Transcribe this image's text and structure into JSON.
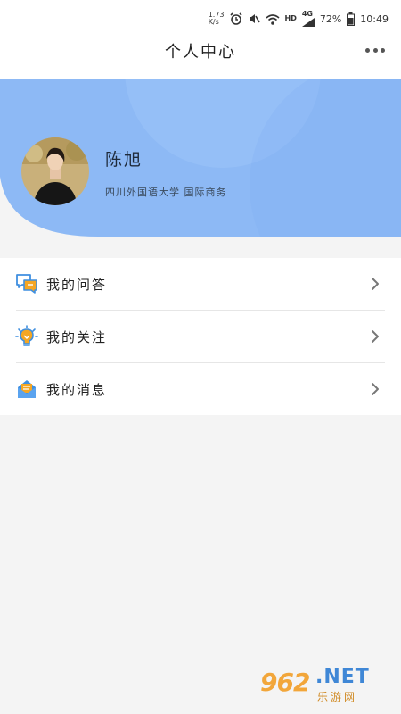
{
  "status_bar": {
    "network_a": "1.73",
    "network_b": "K/s",
    "hd": "HD",
    "lte": "4G",
    "battery": "72%",
    "time": "10:49"
  },
  "header": {
    "title": "个人中心",
    "more_icon": "more-dots-icon"
  },
  "profile": {
    "name": "陈旭",
    "school": "四川外国语大学  国际商务",
    "hero_color": "#8db9f5"
  },
  "menu": {
    "items": [
      {
        "label": "我的问答",
        "icon": "chat-bubbles-icon"
      },
      {
        "label": "我的关注",
        "icon": "lightbulb-icon"
      },
      {
        "label": "我的消息",
        "icon": "envelope-icon"
      }
    ]
  },
  "watermark": {
    "logo": "962",
    "site": ".NET",
    "sub": "乐游网"
  },
  "colors": {
    "accent": "#3f8fe0",
    "icon_orange": "#f5a623",
    "page_bg": "#f4f4f4"
  }
}
